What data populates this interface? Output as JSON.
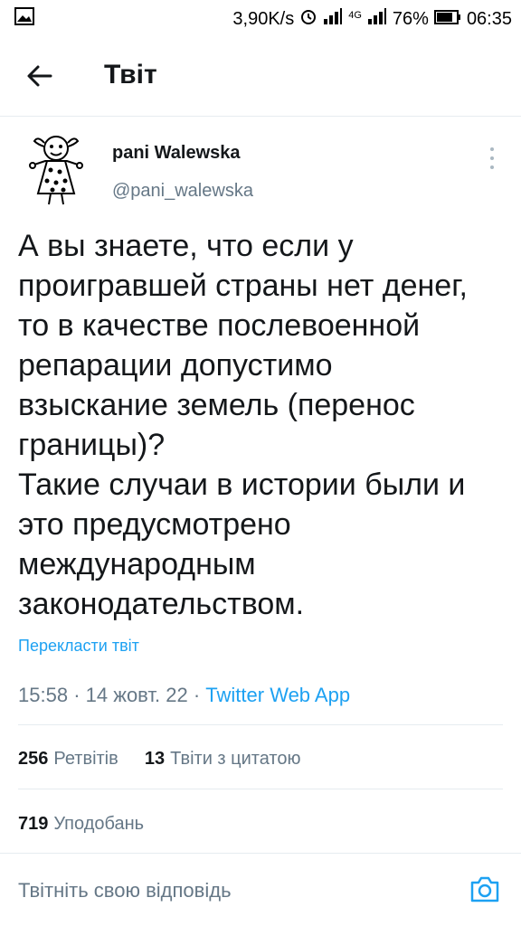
{
  "statusbar": {
    "speed": "3,90K/s",
    "net_type": "4G",
    "battery": "76%",
    "time": "06:35"
  },
  "header": {
    "title": "Твіт"
  },
  "tweet": {
    "author_name": "pani Walewska",
    "author_handle": "@pani_walewska",
    "text": "А вы знаете, что если у\nпроигравшей страны нет денег,\nто в качестве послевоенной\nрепарации допустимо\nвзыскание земель (перенос\nграницы)?\nТакие случаи в истории были и\nэто предусмотрено\nмеждународным\nзаконодательством.",
    "translate_label": "Перекласти твіт",
    "time": "15:58",
    "date": "14 жовт. 22",
    "source": "Twitter Web App"
  },
  "stats": {
    "retweets_count": "256",
    "retweets_label": "Ретвітів",
    "quotes_count": "13",
    "quotes_label": "Твіти з цитатою",
    "likes_count": "719",
    "likes_label": "Уподобань"
  },
  "reply": {
    "placeholder": "Твітніть свою відповідь"
  },
  "colors": {
    "accent": "#1da1f2",
    "secondary_text": "#657786",
    "divider": "#e6ecf0"
  }
}
